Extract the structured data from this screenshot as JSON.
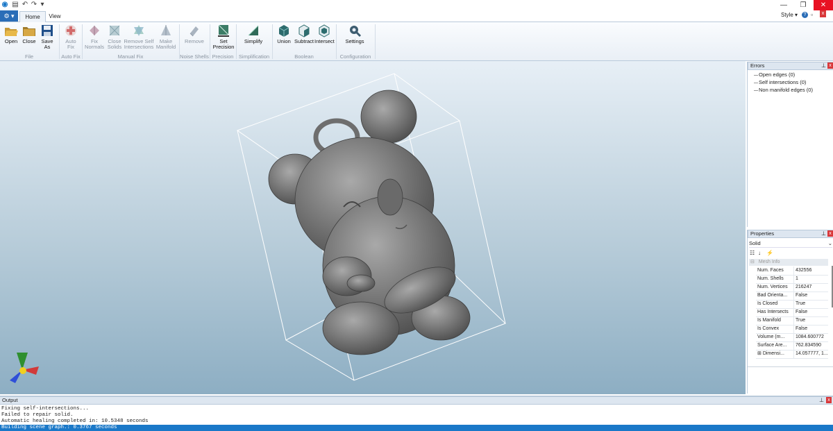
{
  "titlebar": {
    "style_label": "Style",
    "icons": [
      "app-icon",
      "open-icon",
      "undo-icon",
      "redo-icon",
      "dropdown-icon"
    ],
    "window_buttons": [
      "minimize",
      "maximize",
      "close"
    ]
  },
  "tabs": [
    "Home",
    "View"
  ],
  "ribbon": {
    "groups": [
      {
        "label": "File"
      },
      {
        "label": "Auto Fix"
      },
      {
        "label": "Manual Fix"
      },
      {
        "label": "Noise Shells"
      },
      {
        "label": "Precision"
      },
      {
        "label": "Simplification"
      },
      {
        "label": "Boolean"
      },
      {
        "label": "Configuration"
      }
    ],
    "buttons": {
      "open": "Open",
      "close": "Close",
      "save_as": [
        "Save",
        "As"
      ],
      "auto_fix": [
        "Auto",
        "Fix"
      ],
      "fix_normals": [
        "Fix",
        "Normals"
      ],
      "close_solids": [
        "Close",
        "Solids"
      ],
      "remove_self_int": [
        "Remove Self",
        "Intersections"
      ],
      "make_manifold": [
        "Make",
        "Manifold"
      ],
      "remove": "Remove",
      "set_precision": [
        "Set",
        "Precision"
      ],
      "simplify": "Simplify",
      "union": "Union",
      "subtract": "Subtract",
      "intersect": "Intersect",
      "settings": "Settings"
    }
  },
  "errors": {
    "title": "Errors",
    "items": [
      "Open edges (0)",
      "Self intersections (0)",
      "Non manifold edges (0)"
    ]
  },
  "properties": {
    "title": "Properties",
    "selected": "Solid",
    "category": "Mesh Info",
    "rows": [
      {
        "k": "Num. Faces",
        "v": "432556"
      },
      {
        "k": "Num. Shells",
        "v": "1"
      },
      {
        "k": "Num. Vertices",
        "v": "216247"
      },
      {
        "k": "Bad Orienta...",
        "v": "False"
      },
      {
        "k": "Is Closed",
        "v": "True"
      },
      {
        "k": "Has Intersects",
        "v": "False"
      },
      {
        "k": "Is Manifold",
        "v": "True"
      },
      {
        "k": "Is Convex",
        "v": "False"
      },
      {
        "k": "Volume (m...",
        "v": "1084.600772"
      },
      {
        "k": "Surface Are...",
        "v": "762.834590"
      },
      {
        "k": "Dimensi...",
        "v": "14.057777, 1..."
      }
    ]
  },
  "output": {
    "title": "Output",
    "lines": [
      "Fixing self-intersections...",
      "Failed to repair solid.",
      "Automatic healing completed in: 10.5348 seconds",
      "Building scene graph.: 0.3767 seconds"
    ]
  }
}
